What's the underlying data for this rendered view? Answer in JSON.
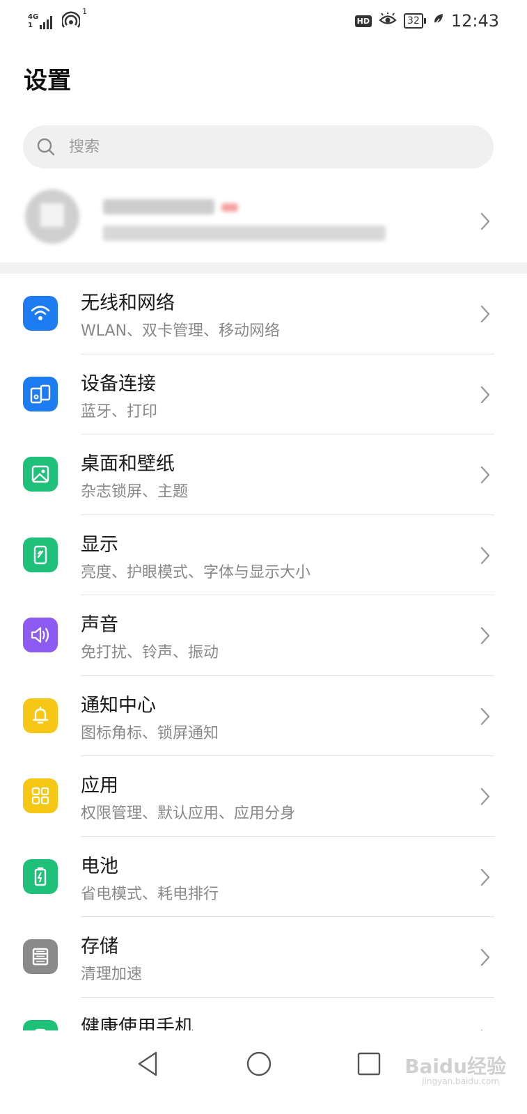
{
  "status_bar": {
    "network_top": "4G",
    "network_bottom": "1",
    "hotspot_count": "1",
    "hd_label": "HD",
    "battery_level": "32",
    "time": "12:43"
  },
  "page": {
    "title": "设置"
  },
  "search": {
    "placeholder": "搜索"
  },
  "settings": [
    {
      "title": "无线和网络",
      "subtitle": "WLAN、双卡管理、移动网络",
      "icon": "wifi-icon",
      "color": "#1E7CF2"
    },
    {
      "title": "设备连接",
      "subtitle": "蓝牙、打印",
      "icon": "device-connection-icon",
      "color": "#1E7CF2"
    },
    {
      "title": "桌面和壁纸",
      "subtitle": "杂志锁屏、主题",
      "icon": "wallpaper-icon",
      "color": "#1FC07A"
    },
    {
      "title": "显示",
      "subtitle": "亮度、护眼模式、字体与显示大小",
      "icon": "display-icon",
      "color": "#1FC07A"
    },
    {
      "title": "声音",
      "subtitle": "免打扰、铃声、振动",
      "icon": "sound-icon",
      "color": "#8E5BF2"
    },
    {
      "title": "通知中心",
      "subtitle": "图标角标、锁屏通知",
      "icon": "bell-icon",
      "color": "#F6C714"
    },
    {
      "title": "应用",
      "subtitle": "权限管理、默认应用、应用分身",
      "icon": "apps-icon",
      "color": "#F6C714"
    },
    {
      "title": "电池",
      "subtitle": "省电模式、耗电排行",
      "icon": "battery-icon",
      "color": "#1FC07A"
    },
    {
      "title": "存储",
      "subtitle": "清理加速",
      "icon": "storage-icon",
      "color": "#8A8A8A"
    },
    {
      "title": "健康使用手机",
      "subtitle": "",
      "icon": "health-icon",
      "color": "#1FC07A"
    }
  ],
  "watermark": {
    "main": "Baidu经验",
    "sub": "jingyan.baidu.com"
  }
}
